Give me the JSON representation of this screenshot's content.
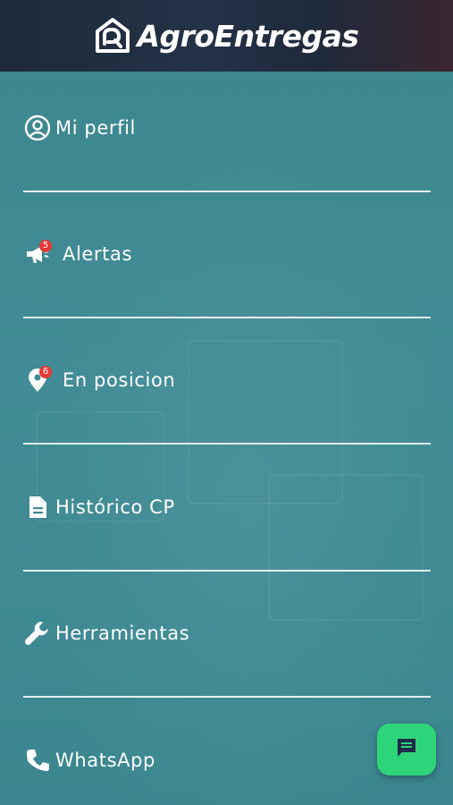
{
  "header": {
    "brand_name": "AgroEntregas",
    "logo_icon": "house-logo-icon",
    "background": "#1f2b3c"
  },
  "menu": {
    "items": [
      {
        "label": "Mi perfil",
        "icon": "account-circle-icon",
        "badge": null
      },
      {
        "label": "Alertas",
        "icon": "megaphone-icon",
        "badge": "5"
      },
      {
        "label": "En posicion",
        "icon": "location-pin-icon",
        "badge": "6"
      },
      {
        "label": "Histórico CP",
        "icon": "document-icon",
        "badge": null
      },
      {
        "label": "Herramientas",
        "icon": "wrench-icon",
        "badge": null
      },
      {
        "label": "WhatsApp",
        "icon": "phone-icon",
        "badge": null
      }
    ]
  },
  "fab": {
    "icon": "chat-message-icon",
    "color": "#2ed47a"
  },
  "colors": {
    "content_background": "#3f8a93",
    "badge": "#e53935",
    "text": "#ffffff"
  }
}
